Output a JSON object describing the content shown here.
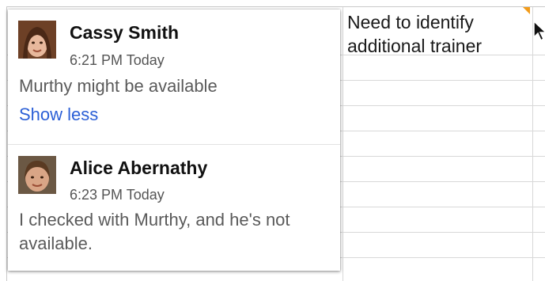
{
  "sheet": {
    "cell_text": "Need to identify additional trainer",
    "comment_indicator_color": "#f29b1a"
  },
  "comments": [
    {
      "author": "Cassy Smith",
      "timestamp": "6:21 PM Today",
      "body": "Murthy might be available",
      "show_less_label": "Show less"
    },
    {
      "author": "Alice Abernathy",
      "timestamp": "6:23 PM Today",
      "body": "I checked with Murthy, and he's not available."
    }
  ],
  "icons": {
    "cursor": "mouse-pointer-icon"
  }
}
